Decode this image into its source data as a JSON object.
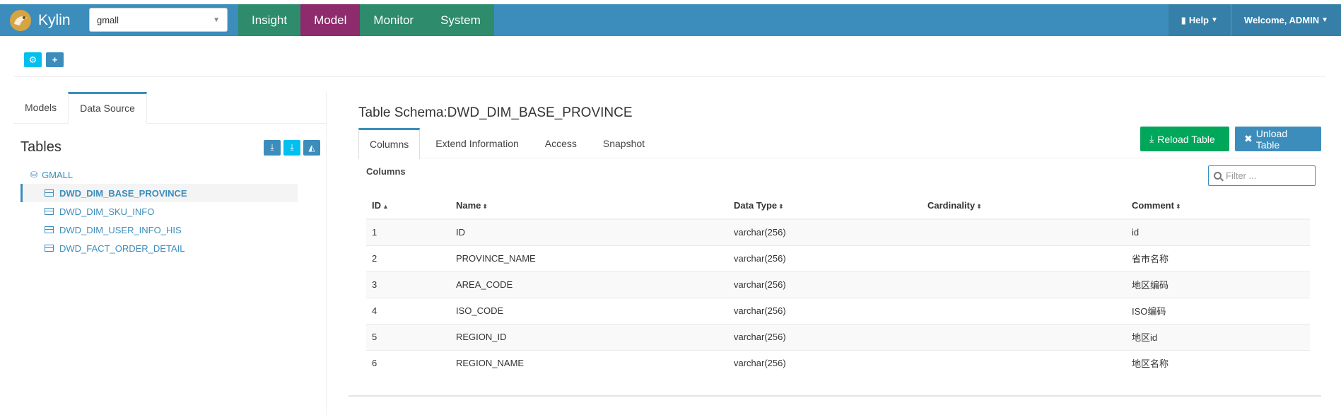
{
  "navbar": {
    "brand": "Kylin",
    "project": "gmall",
    "tabs": [
      {
        "label": "Insight",
        "active": false
      },
      {
        "label": "Model",
        "active": true
      },
      {
        "label": "Monitor",
        "active": false
      },
      {
        "label": "System",
        "active": false
      }
    ],
    "help_label": "Help",
    "welcome_label": "Welcome, ADMIN"
  },
  "left": {
    "tabs": [
      {
        "label": "Models",
        "active": false
      },
      {
        "label": "Data Source",
        "active": true
      }
    ],
    "tables_title": "Tables",
    "database": "GMALL",
    "tables": [
      {
        "name": "DWD_DIM_BASE_PROVINCE",
        "active": true
      },
      {
        "name": "DWD_DIM_SKU_INFO",
        "active": false
      },
      {
        "name": "DWD_DIM_USER_INFO_HIS",
        "active": false
      },
      {
        "name": "DWD_FACT_ORDER_DETAIL",
        "active": false
      }
    ]
  },
  "right": {
    "schema_title": "Table Schema:DWD_DIM_BASE_PROVINCE",
    "tabs": [
      {
        "label": "Columns",
        "active": true
      },
      {
        "label": "Extend Information",
        "active": false
      },
      {
        "label": "Access",
        "active": false
      },
      {
        "label": "Snapshot",
        "active": false
      }
    ],
    "reload_label": "Reload Table",
    "unload_label": "Unload Table",
    "columns_label": "Columns",
    "filter_placeholder": "Filter ...",
    "headers": [
      "ID",
      "Name",
      "Data Type",
      "Cardinality",
      "Comment"
    ],
    "rows": [
      {
        "id": "1",
        "name": "ID",
        "type": "varchar(256)",
        "cardinality": "",
        "comment": "id"
      },
      {
        "id": "2",
        "name": "PROVINCE_NAME",
        "type": "varchar(256)",
        "cardinality": "",
        "comment": "省市名称"
      },
      {
        "id": "3",
        "name": "AREA_CODE",
        "type": "varchar(256)",
        "cardinality": "",
        "comment": "地区编码"
      },
      {
        "id": "4",
        "name": "ISO_CODE",
        "type": "varchar(256)",
        "cardinality": "",
        "comment": "ISO编码"
      },
      {
        "id": "5",
        "name": "REGION_ID",
        "type": "varchar(256)",
        "cardinality": "",
        "comment": "地区id"
      },
      {
        "id": "6",
        "name": "REGION_NAME",
        "type": "varchar(256)",
        "cardinality": "",
        "comment": "地区名称"
      }
    ]
  },
  "colors": {
    "navbar": "#3c8dbc",
    "nav_green": "#2e8b6b",
    "nav_active": "#8e2b6d",
    "btn_success": "#00a65a",
    "btn_info": "#00c0ef"
  }
}
